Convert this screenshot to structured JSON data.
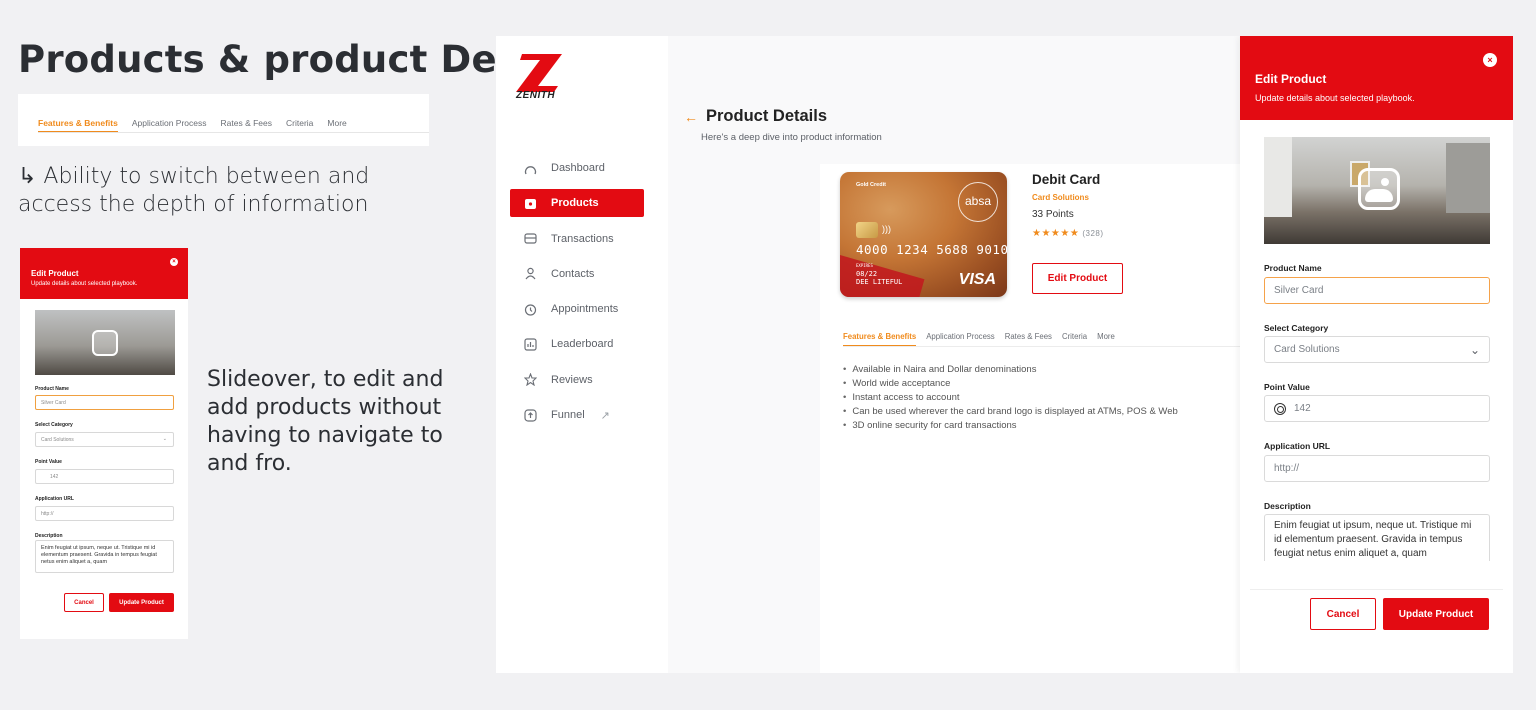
{
  "presentation": {
    "title": "Products & product Details",
    "note_tabs": "↳ Ability to switch between and access the depth of information",
    "note_slideover": "Slideover, to edit and add products without having to navigate to and fro.",
    "mini_tabs": [
      "Features & Benefits",
      "Application Process",
      "Rates & Fees",
      "Criteria",
      "More"
    ]
  },
  "mini_panel": {
    "title": "Edit Product",
    "subtitle": "Update details about selected playbook.",
    "product_name_label": "Product Name",
    "product_name_value": "Silver Card",
    "category_label": "Select Category",
    "category_value": "Card Solutions",
    "point_label": "Point Value",
    "point_value": "142",
    "url_label": "Application URL",
    "url_placeholder": "http://",
    "description_label": "Description",
    "description_value": "Enim feugiat ut ipsum, neque ut. Tristique mi id elementum praesent. Gravida in tempus feugiat netus enim aliquet a, quam",
    "cancel_label": "Cancel",
    "update_label": "Update Product"
  },
  "app": {
    "logo_text": "ZENITH",
    "brand_color": "#e30b12",
    "accent_color": "#f08b1d",
    "nav": [
      {
        "label": "Dashboard",
        "icon": "dashboard-icon"
      },
      {
        "label": "Products",
        "icon": "products-icon",
        "active": true
      },
      {
        "label": "Transactions",
        "icon": "transactions-icon"
      },
      {
        "label": "Contacts",
        "icon": "contacts-icon"
      },
      {
        "label": "Appointments",
        "icon": "appointments-icon"
      },
      {
        "label": "Leaderboard",
        "icon": "leaderboard-icon"
      },
      {
        "label": "Reviews",
        "icon": "reviews-icon"
      },
      {
        "label": "Funnel",
        "icon": "funnel-icon",
        "external": true
      }
    ],
    "page_title": "Product Details",
    "page_subtitle": "Here's a deep dive into product information",
    "card": {
      "tier": "Gold Credit",
      "brand": "absa",
      "number": "4000 1234 5688 9010",
      "expiry_label": "EXPIRES",
      "expiry": "08/22",
      "holder": "DEE LITEFUL",
      "network": "VISA"
    },
    "product": {
      "name": "Debit Card",
      "category": "Card Solutions",
      "points": "33 Points",
      "stars": "★★★★★",
      "rating_count": "(328)",
      "edit_label": "Edit Product"
    },
    "tabs": [
      "Features & Benefits",
      "Application Process",
      "Rates & Fees",
      "Criteria",
      "More"
    ],
    "features": [
      "Available in Naira and Dollar denominations",
      "World wide acceptance",
      "Instant access to account",
      "Can be used wherever the card brand logo is displayed at ATMs, POS & Web",
      "3D online security for card transactions"
    ]
  },
  "slideover": {
    "title": "Edit Product",
    "subtitle": "Update details about selected playbook.",
    "product_name_label": "Product Name",
    "product_name_value": "Silver Card",
    "category_label": "Select Category",
    "category_value": "Card Solutions",
    "point_label": "Point Value",
    "point_value": "142",
    "url_label": "Application URL",
    "url_placeholder": "http://",
    "description_label": "Description",
    "description_value": "Enim feugiat ut ipsum, neque ut. Tristique mi id elementum praesent. Gravida in tempus feugiat netus enim aliquet a, quam",
    "cancel_label": "Cancel",
    "update_label": "Update Product"
  }
}
